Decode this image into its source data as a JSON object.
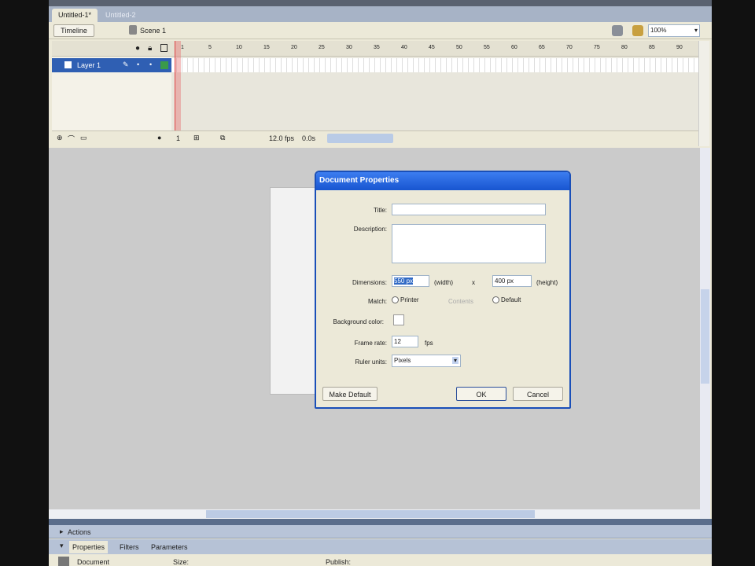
{
  "tabs": [
    {
      "label": "Untitled-1*",
      "active": true
    },
    {
      "label": "Untitled-2",
      "active": false
    }
  ],
  "toolbar": {
    "timeline_label": "Timeline",
    "scene_label": "Scene 1",
    "zoom": "100%"
  },
  "timeline": {
    "frame_numbers": [
      "1",
      "5",
      "10",
      "15",
      "20",
      "25",
      "30",
      "35",
      "40",
      "45",
      "50",
      "55",
      "60",
      "65",
      "70",
      "75",
      "80",
      "85",
      "90"
    ],
    "layers": [
      {
        "name": "Layer 1"
      }
    ],
    "current_frame": "1",
    "frame_rate": "12.0 fps",
    "elapsed": "0.0s"
  },
  "dialog": {
    "title": "Document Properties",
    "title_label": "Title:",
    "title_value": "",
    "description_label": "Description:",
    "description_value": "",
    "dimensions_label": "Dimensions:",
    "width_value": "550 px",
    "width_label": "(width)",
    "x": "x",
    "height_value": "400 px",
    "height_label": "(height)",
    "match_label": "Match:",
    "match_options": [
      "Printer",
      "Contents",
      "Default"
    ],
    "bg_label": "Background color:",
    "bg_color": "#ffffff",
    "framerate_label": "Frame rate:",
    "framerate_value": "12",
    "fps": "fps",
    "ruler_label": "Ruler units:",
    "ruler_value": "Pixels",
    "make_default": "Make Default",
    "ok": "OK",
    "cancel": "Cancel"
  },
  "panels": {
    "actions": "Actions",
    "tabs": [
      "Properties",
      "Filters",
      "Parameters"
    ],
    "doc_label": "Document",
    "size_label": "Size:",
    "publish_label": "Publish:"
  }
}
